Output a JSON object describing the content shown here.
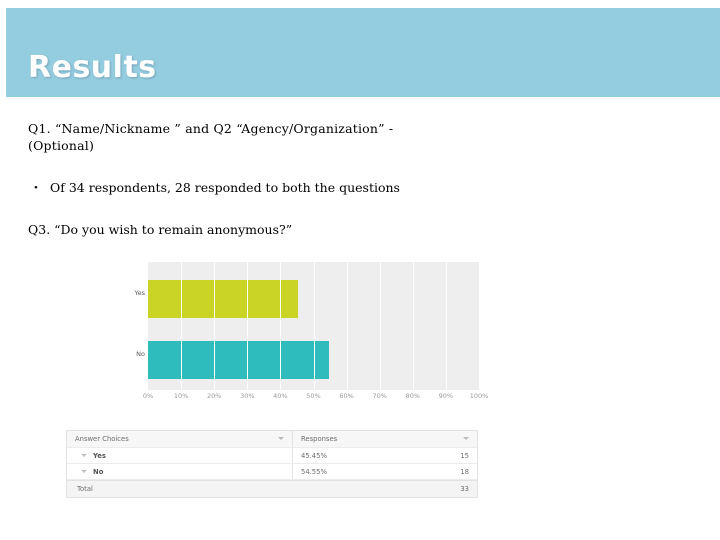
{
  "header": {
    "title": "Results",
    "banner_color": "#95cde0"
  },
  "body": {
    "q1_q2_line1": "Q1.  “Name/Nickname  ”  and  Q2  “Agency/Organization”    -",
    "q1_q2_line2": "(Optional)",
    "bullet_marker": "•",
    "bullet_text": "Of 34 respondents, 28 responded to both the questions",
    "q3_line": "Q3. “Do you wish to remain anonymous?”"
  },
  "chart_data": {
    "type": "bar",
    "orientation": "horizontal",
    "title": "",
    "xlabel": "",
    "ylabel": "",
    "categories": [
      "Yes",
      "No"
    ],
    "values": [
      45.45,
      54.55
    ],
    "value_unit": "%",
    "xlim": [
      0,
      100
    ],
    "tick_labels": [
      "0%",
      "10%",
      "20%",
      "30%",
      "40%",
      "50%",
      "60%",
      "70%",
      "80%",
      "90%",
      "100%"
    ],
    "tick_values": [
      0,
      10,
      20,
      30,
      40,
      50,
      60,
      70,
      80,
      90,
      100
    ],
    "grid": true,
    "legend": false,
    "plot_background": "#eeeeee",
    "series": [
      {
        "name": "Yes",
        "value": 45.45,
        "color": "#cad425"
      },
      {
        "name": "No",
        "value": 54.55,
        "color": "#2fbcbd"
      }
    ]
  },
  "table": {
    "columns": [
      "Answer Choices",
      "Responses"
    ],
    "rows": [
      {
        "choice": "Yes",
        "percent": "45.45%",
        "count": "15"
      },
      {
        "choice": "No",
        "percent": "54.55%",
        "count": "18"
      }
    ],
    "total_label": "Total",
    "total_count": "33"
  }
}
